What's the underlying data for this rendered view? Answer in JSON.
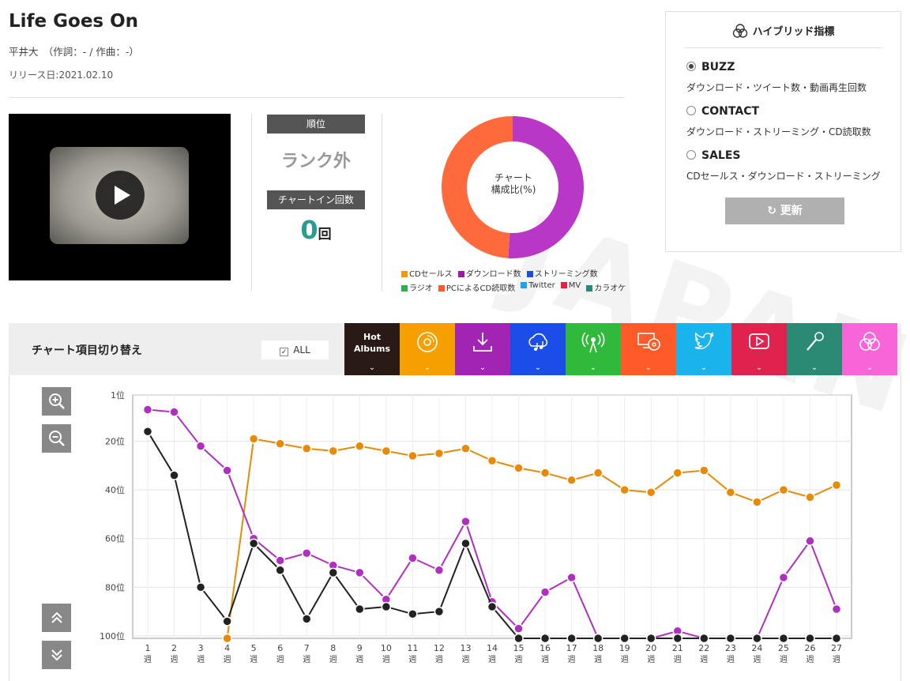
{
  "song": {
    "title": "Life Goes On",
    "artist": "平井大　（作詞：- / 作曲：-）",
    "release": "リリース日:2021.02.10"
  },
  "rank": {
    "rank_label": "順位",
    "rank_value": "ランク外",
    "chartin_label": "チャートイン回数",
    "chartin_value": "0",
    "chartin_unit": "回"
  },
  "donut": {
    "center_line1": "チャート",
    "center_line2": "構成比(%)",
    "segments": [
      {
        "name": "ダウンロード数",
        "percent": 51,
        "color": "#b837c6"
      },
      {
        "name": "PCによるCD読取数",
        "percent": 49,
        "color": "#ff6a3d"
      }
    ],
    "legend_row1": [
      {
        "label": "CDセールス",
        "color": "#f29b0a"
      },
      {
        "label": "ダウンロード数",
        "color": "#9b1ba8"
      },
      {
        "label": "ストリーミング数",
        "color": "#1a4fe0"
      }
    ],
    "legend_row2": [
      {
        "label": "ラジオ",
        "color": "#2db14a"
      },
      {
        "label": "PCによるCD読取数",
        "color": "#ff5a2a"
      },
      {
        "label": "Twitter",
        "color": "#1da1f2"
      },
      {
        "label": "MV",
        "color": "#e0233e"
      },
      {
        "label": "カラオケ",
        "color": "#2a8a7a"
      }
    ]
  },
  "hybrid": {
    "title": "ハイブリッド指標",
    "options": [
      {
        "label": "BUZZ",
        "desc": "ダウンロード・ツイート数・動画再生回数",
        "selected": true
      },
      {
        "label": "CONTACT",
        "desc": "ダウンロード・ストリーミング・CD読取数",
        "selected": false
      },
      {
        "label": "SALES",
        "desc": "CDセールス・ダウンロード・ストリーミング",
        "selected": false
      }
    ],
    "update_label": "更新"
  },
  "switcher": {
    "label": "チャート項目切り替え",
    "all_label": "ALL",
    "hot_line1": "Hot",
    "hot_line2": "Albums",
    "tabs": [
      {
        "icon": "cd-icon",
        "color": "#f5a000"
      },
      {
        "icon": "download-icon",
        "color": "#a124b3"
      },
      {
        "icon": "streaming-icon",
        "color": "#1b4ee6"
      },
      {
        "icon": "radio-icon",
        "color": "#30b93a"
      },
      {
        "icon": "pc-cd-icon",
        "color": "#ff5a2a"
      },
      {
        "icon": "twitter-icon",
        "color": "#1ab3ec"
      },
      {
        "icon": "youtube-icon",
        "color": "#e0234e"
      },
      {
        "icon": "karaoke-icon",
        "color": "#2a8a74"
      },
      {
        "icon": "hybrid-icon",
        "color": "#f765d8"
      }
    ]
  },
  "chart_data": {
    "type": "line",
    "x": [
      "1",
      "2",
      "3",
      "4",
      "5",
      "6",
      "7",
      "8",
      "9",
      "10",
      "11",
      "12",
      "13",
      "14",
      "15",
      "16",
      "17",
      "18",
      "19",
      "20",
      "21",
      "22",
      "23",
      "24",
      "25",
      "26",
      "27"
    ],
    "x_unit": "週",
    "y_ticks": [
      "1位",
      "20位",
      "40位",
      "60位",
      "80位",
      "100位"
    ],
    "ylim": [
      100,
      1
    ],
    "inverted": true,
    "grid": true,
    "series": [
      {
        "color": "#e88a06",
        "values": [
          null,
          null,
          null,
          101,
          19,
          21,
          23,
          24,
          22,
          24,
          26,
          25,
          23,
          28,
          31,
          33,
          36,
          33,
          40,
          41,
          33,
          32,
          41,
          45,
          40,
          43,
          38
        ]
      },
      {
        "color": "#b02fc0",
        "values": [
          7,
          8,
          22,
          32,
          60,
          69,
          66,
          71,
          74,
          85,
          68,
          73,
          53,
          86,
          97,
          82,
          76,
          101,
          null,
          101,
          98,
          101,
          null,
          101,
          76,
          61,
          89
        ]
      },
      {
        "color": "#222222",
        "values": [
          16,
          34,
          80,
          94,
          62,
          73,
          93,
          74,
          89,
          88,
          91,
          90,
          62,
          88,
          101,
          101,
          101,
          101,
          101,
          101,
          101,
          101,
          101,
          101,
          101,
          101,
          101
        ]
      }
    ]
  }
}
